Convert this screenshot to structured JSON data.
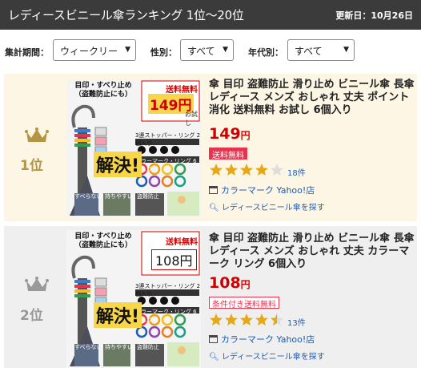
{
  "header": {
    "title": "レディースビニール傘ランキング 1位～20位",
    "updated": "更新日：10月26日"
  },
  "filters": {
    "period_label": "集計期間：",
    "period_value": "ウィークリー",
    "gender_label": "性別：",
    "gender_value": "すべて",
    "age_label": "年代別：",
    "age_value": "すべて"
  },
  "items": [
    {
      "rank": "1位",
      "title": "傘 目印 盗難防止 滑り止め ビニール傘 長傘 レディース メンズ おしゃれ 丈夫 ポイント消化 送料無料 お試し 6個入り",
      "price": "149",
      "yen": "円",
      "badge": "送料無料",
      "rating": 4.0,
      "reviews": "18件",
      "shop": "カラーマーク Yahoo!店",
      "find": "レディースビニール傘を探す",
      "thumb": {
        "top_text": "目印・すべり止め（盗難防止にも）",
        "sale_label": "送料無料",
        "sale_price": "149円",
        "sale_note": "お試し",
        "stopper_text": "3連ストッパー・リング 2個入り",
        "ring_text": "カラーマーク・リング 6個入り",
        "kaiketsu": "解決!",
        "b1": "すべらない",
        "b2": "持ちやすい",
        "b3": "盗難防止"
      }
    },
    {
      "rank": "2位",
      "title": "傘 目印 盗難防止 滑り止め ビニール傘 長傘 レディース メンズ おしゃれ 丈夫 カラーマーク リング 6個入り",
      "price": "108",
      "yen": "円",
      "badge": "条件付き送料無料",
      "rating": 4.5,
      "reviews": "13件",
      "shop": "カラーマーク Yahoo!店",
      "find": "レディースビニール傘を探す",
      "thumb": {
        "top_text": "目印・すべり止め（盗難防止にも）",
        "sale_label": "送料無料",
        "sale_price": "108円",
        "sale_note": "",
        "stopper_text": "3連ストッパー・リング 2個入り",
        "ring_text": "カラーマーク・リング 6個入り",
        "kaiketsu": "解決!",
        "b1": "すべらない",
        "b2": "持ちやすい",
        "b3": "盗難防止"
      }
    }
  ],
  "colors": {
    "header_bg": "#3b3b3b",
    "row1_bg": "#fdf6e4",
    "row2_bg": "#efefef",
    "gold": "#b39544",
    "silver": "#999999",
    "price": "#d10000",
    "badge": "#e53350",
    "link": "#1d5cb4",
    "star": "#e6a817"
  },
  "icons": [
    "crown-gold-icon",
    "crown-silver-icon",
    "star-icon",
    "shop-icon",
    "search-icon",
    "chevron-down-icon"
  ]
}
